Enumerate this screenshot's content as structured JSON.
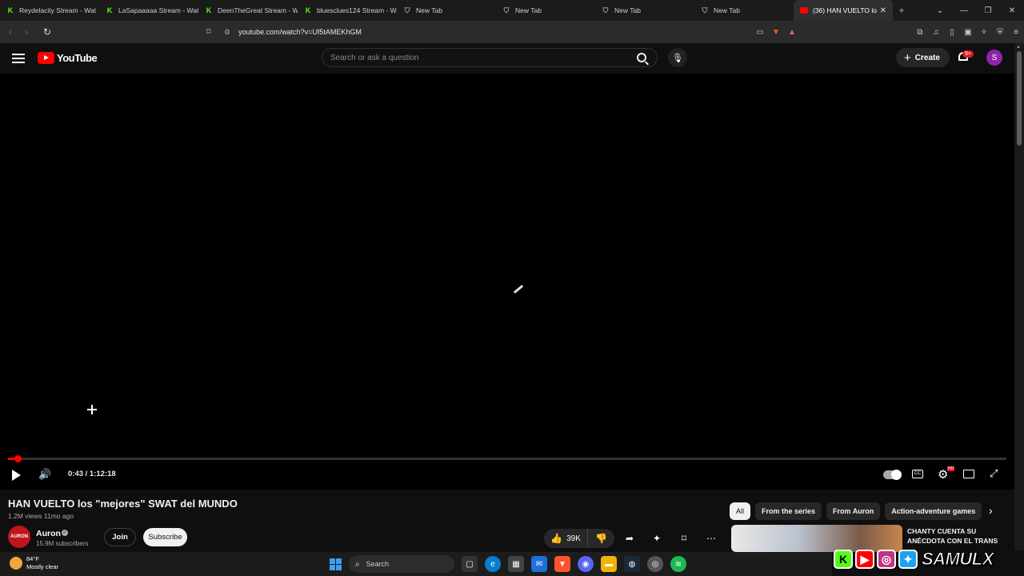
{
  "browser": {
    "tabs": [
      {
        "title": "Reydelacity Stream - Wat",
        "icon": "kick-icon"
      },
      {
        "title": "LaSapaaaaa Stream - Wat",
        "icon": "kick-icon"
      },
      {
        "title": "DeenTheGreat Stream - W",
        "icon": "kick-icon"
      },
      {
        "title": "bluesclues124 Stream - W",
        "icon": "kick-icon"
      },
      {
        "title": "New Tab",
        "icon": "shield-icon"
      },
      {
        "title": "New Tab",
        "icon": "shield-icon"
      },
      {
        "title": "New Tab",
        "icon": "shield-icon"
      },
      {
        "title": "New Tab",
        "icon": "shield-icon"
      },
      {
        "title": "(36) HAN VUELTO lo",
        "icon": "youtube-icon",
        "active": true
      }
    ],
    "url": "youtube.com/watch?v=Uf5tAMEKhGM"
  },
  "youtube": {
    "logo_text": "YouTube",
    "search_placeholder": "Search or ask a question",
    "create_label": "Create",
    "notification_count": "9+",
    "avatar_letter": "S"
  },
  "player": {
    "current_time": "0:43",
    "duration": "1:12:18",
    "time_display": "0:43 / 1:12:18",
    "progress_fraction": 0.0099
  },
  "video": {
    "title": "HAN VUELTO los \"mejores\" SWAT del MUNDO",
    "meta": "1.2M views  11mo ago",
    "channel": "Auron",
    "subscribers": "15.9M subscribers",
    "join_label": "Join",
    "subscribe_label": "Subscribe",
    "likes": "39K"
  },
  "chips": [
    "All",
    "From the series",
    "From Auron",
    "Action-adventure games"
  ],
  "recommended": {
    "title": "CHANTY CUENTA SU ANÉCDOTA CON EL TRANS"
  },
  "watermark": {
    "text": "SAMULX"
  },
  "taskbar": {
    "temperature": "84°F",
    "weather": "Mostly clear",
    "search_label": "Search"
  },
  "colors": {
    "youtube_red": "#ff0000",
    "kick_green": "#53fc18",
    "background": "#0f0f0f"
  }
}
